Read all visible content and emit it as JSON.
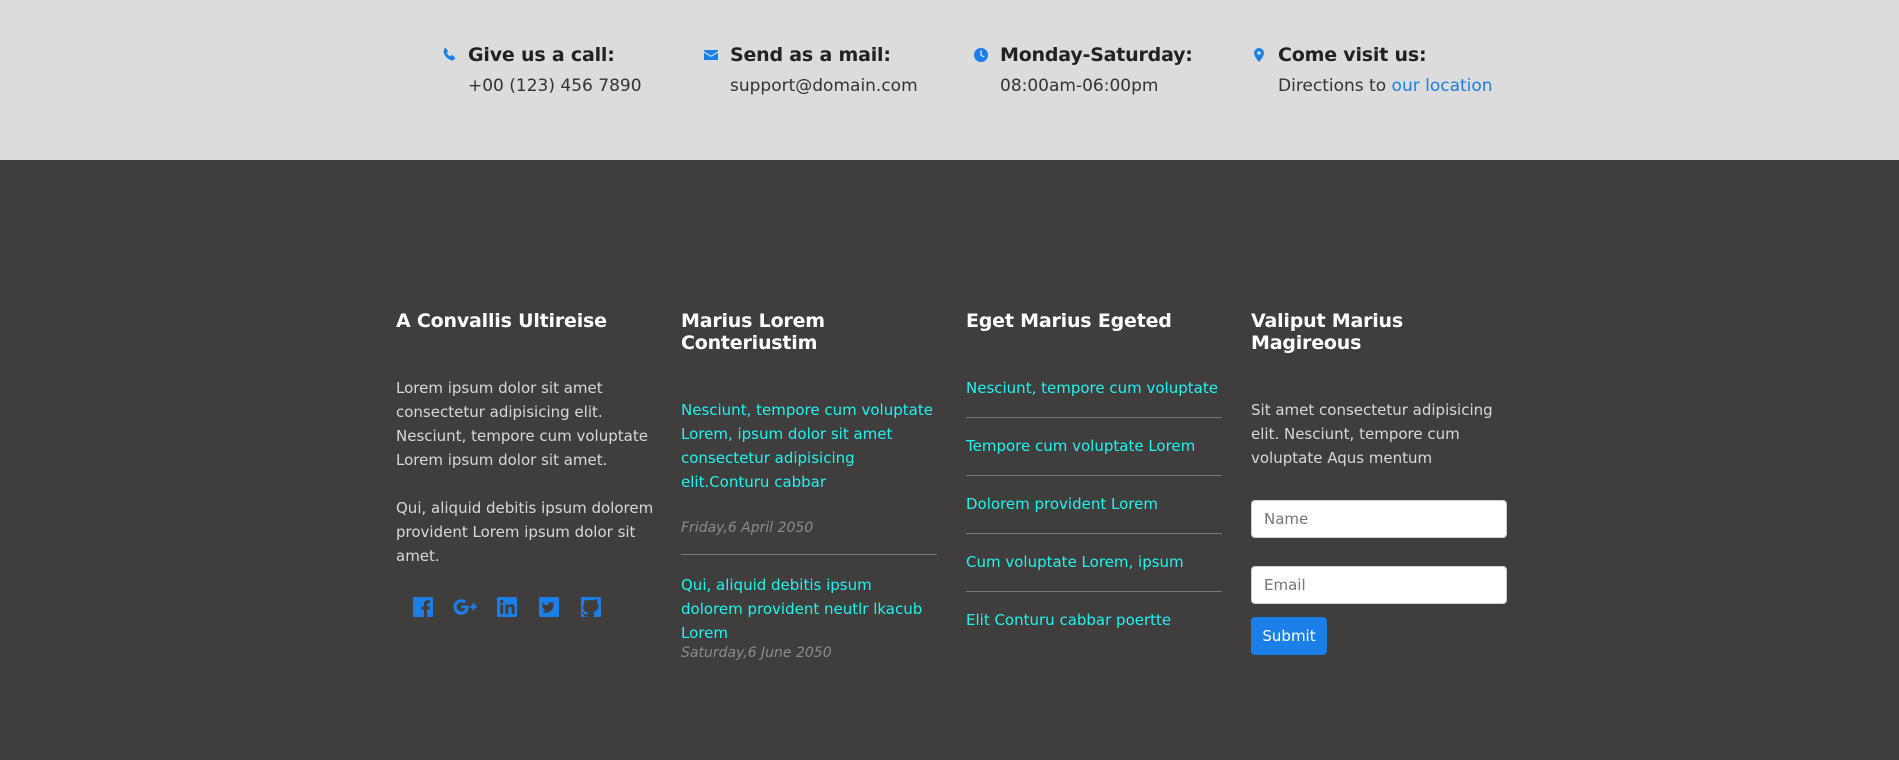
{
  "contact_bar": {
    "call": {
      "title": "Give us a call:",
      "value": "+00 (123) 456 7890",
      "icon": "phone-icon"
    },
    "mail": {
      "title": "Send as a mail:",
      "value": "support@domain.com",
      "icon": "envelope-icon"
    },
    "hours": {
      "title": "Monday-Saturday:",
      "value": "08:00am-06:00pm",
      "icon": "clock-icon"
    },
    "visit": {
      "title": "Come visit us:",
      "prefix": "Directions to",
      "link": "our location",
      "icon": "map-pin-icon"
    },
    "accent": "#1a7fe8"
  },
  "footer": {
    "col1": {
      "title": "A Convallis Ultireise",
      "p1": "Lorem ipsum dolor sit amet consectetur adipisicing elit. Nesciunt, tempore cum voluptate Lorem ipsum dolor sit amet.",
      "p2": "Qui, aliquid debitis ipsum dolorem provident Lorem ipsum dolor sit amet.",
      "social": [
        "facebook-icon",
        "google-plus-icon",
        "linkedin-icon",
        "twitter-icon",
        "github-icon"
      ]
    },
    "col2": {
      "title": "Marius Lorem Conteriustim",
      "posts": [
        {
          "text": "Nesciunt, tempore cum voluptate Lorem, ipsum dolor sit amet consectetur adipisicing elit.Conturu cabbar",
          "date": "Friday,6 April 2050"
        },
        {
          "text": "Qui, aliquid debitis ipsum dolorem provident neutlr lkacub Lorem",
          "date": "Saturday,6 June 2050"
        }
      ]
    },
    "col3": {
      "title": "Eget Marius Egeted",
      "links": [
        "Nesciunt, tempore cum voluptate",
        "Tempore cum voluptate Lorem",
        "Dolorem provident Lorem",
        "Cum voluptate Lorem, ipsum",
        "Elit Conturu cabbar poertte"
      ]
    },
    "col4": {
      "title": "Valiput Marius Magireous",
      "text": "Sit amet consectetur adipisicing elit. Nesciunt, tempore cum voluptate Aqus mentum",
      "name_placeholder": "Name",
      "email_placeholder": "Email",
      "submit": "Submit"
    },
    "background": "#403e3c",
    "link_color": "#1ff3f0"
  }
}
